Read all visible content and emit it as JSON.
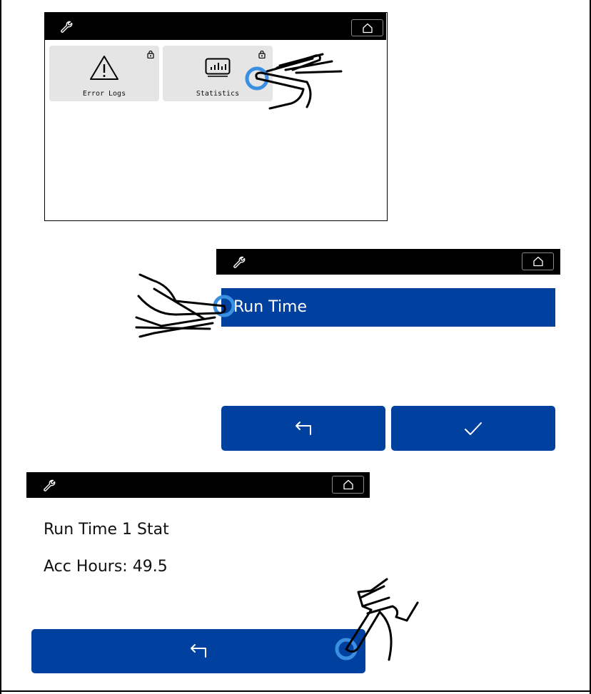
{
  "screen1": {
    "tiles": [
      {
        "label": "Error Logs",
        "icon": "warning-icon",
        "locked": true
      },
      {
        "label": "Statistics",
        "icon": "statistics-icon",
        "locked": true
      }
    ]
  },
  "screen2": {
    "list_item": "Run Time",
    "back_button": "back-arrow-icon",
    "confirm_button": "checkmark-icon"
  },
  "screen3": {
    "title": "Run Time 1 Stat",
    "hours_line": "Acc Hours: 49.5",
    "back_button": "back-arrow-icon"
  },
  "colors": {
    "accent_blue": "#0041a0",
    "tile_gray": "#e5e5e5",
    "topbar": "#000000",
    "touch_ring": "#3b8fe0"
  }
}
